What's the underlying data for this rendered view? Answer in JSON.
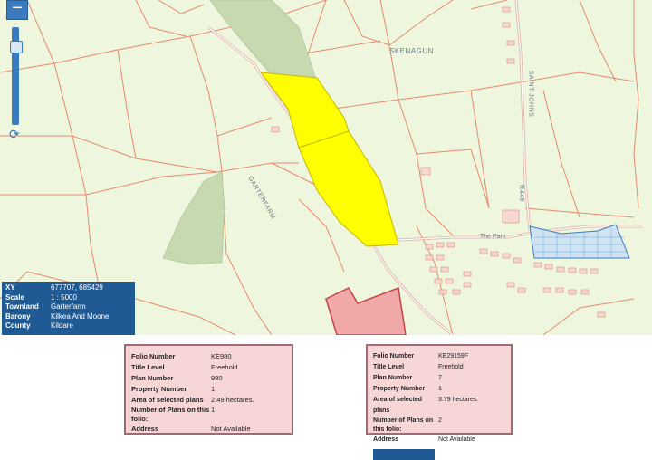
{
  "map": {
    "labels": {
      "townland_north": "SKENAGUN",
      "townland_center": "GARTERFARM",
      "road_saint_johns": "SAINT JOHNS",
      "road_r448": "R448",
      "estate_the_park": "The Park"
    },
    "zoom_in_label": "+"
  },
  "infobox": {
    "rows": [
      {
        "key": "XY",
        "value": "677707, 685429"
      },
      {
        "key": "Scale",
        "value": "1 : 5000"
      },
      {
        "key": "Townland",
        "value": "Garterfarm"
      },
      {
        "key": "Barony",
        "value": "Kilkea And Moone"
      },
      {
        "key": "County",
        "value": "Kildare"
      }
    ]
  },
  "folio_left": {
    "rows": [
      {
        "key": "Folio Number",
        "value": "KE980"
      },
      {
        "key": "Title Level",
        "value": "Freehold"
      },
      {
        "key": "Plan Number",
        "value": "980"
      },
      {
        "key": "Property Number",
        "value": "1"
      },
      {
        "key": "Area of selected plans",
        "value": "2.49 hectares."
      },
      {
        "key": "Number of Plans on this folio:",
        "value": "1"
      },
      {
        "key": "Address",
        "value": "Not Available"
      }
    ]
  },
  "folio_right": {
    "rows": [
      {
        "key": "Folio Number",
        "value": "KE29159F"
      },
      {
        "key": "Title Level",
        "value": "Freehold"
      },
      {
        "key": "Plan Number",
        "value": "7"
      },
      {
        "key": "Property Number",
        "value": "1"
      },
      {
        "key": "Area of selected plans",
        "value": "3.79 hectares."
      },
      {
        "key": "Number of Plans on this folio:",
        "value": "2"
      },
      {
        "key": "Address",
        "value": "Not Available"
      }
    ]
  },
  "colors": {
    "map_bg": "#eef6dd",
    "field_line": "#e58a6f",
    "forest": "#c7d9b0",
    "selected_plot": "#ffff00",
    "blue_panel": "#1f5a95",
    "folio_bg": "#f7d6d8"
  }
}
